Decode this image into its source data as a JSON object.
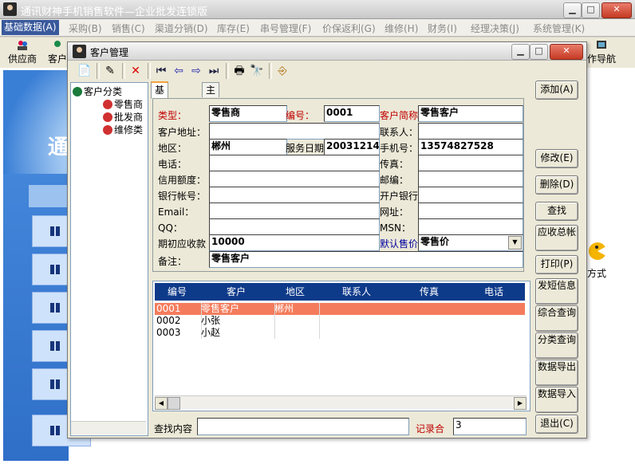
{
  "app": {
    "title": "通讯财神手机销售软件—企业批发连锁版"
  },
  "menu": [
    {
      "label": "基础数据(A)",
      "active": true
    },
    {
      "label": "采购(B)"
    },
    {
      "label": "销售(C)"
    },
    {
      "label": "渠道分销(D)"
    },
    {
      "label": "库存(E)"
    },
    {
      "label": "串号管理(F)"
    },
    {
      "label": "价保返利(G)"
    },
    {
      "label": "维修(H)"
    },
    {
      "label": "财务(I)"
    },
    {
      "label": "经理决策(J)"
    },
    {
      "label": "系统管理(K)"
    }
  ],
  "toolbar": {
    "supplier": "供应商",
    "customer": "客户",
    "nav": "作导航"
  },
  "background": {
    "payment_label": "方式"
  },
  "dialog": {
    "title": "客户管理",
    "tree": {
      "root": "客户分类",
      "children": [
        "零售商",
        "批发商",
        "维修类"
      ]
    },
    "tabs": [
      "基本资料",
      "主要联系人"
    ],
    "form": {
      "type_label": "类型：",
      "type_value": "零售商",
      "code_label": "编号：",
      "code_value": "0001",
      "short_label": "客户简称",
      "short_value": "零售客户",
      "address_label": "客户地址：",
      "address_value": "",
      "contact_label": "联系人：",
      "contact_value": "",
      "region_label": "地区：",
      "region_value": "郴州",
      "service_date_label": "服务日期",
      "service_date_value": "20031214",
      "mobile_label": "手机号：",
      "mobile_value": "13574827528",
      "phone_label": "电话：",
      "phone_value": "",
      "fax_label": "传真：",
      "fax_value": "",
      "credit_label": "信用额度：",
      "credit_value": "",
      "postcode_label": "邮编：",
      "postcode_value": "",
      "bank_label": "银行帐号：",
      "bank_value": "",
      "openbank_label": "开户银行",
      "openbank_value": "",
      "email_label": "Email：",
      "email_value": "",
      "web_label": "网址：",
      "web_value": "",
      "qq_label": "QQ：",
      "qq_value": "",
      "msn_label": "MSN：",
      "msn_value": "",
      "initial_ar_label": "期初应收款",
      "initial_ar_value": "10000",
      "default_price_label": "默认售价",
      "default_price_value": "零售价",
      "note_label": "备注：",
      "note_value": "零售客户"
    },
    "grid": {
      "columns": [
        "编号",
        "客户",
        "地区",
        "联系人",
        "传真",
        "电话"
      ],
      "rows": [
        {
          "code": "0001",
          "name": "零售客户",
          "region": "郴州",
          "selected": true
        },
        {
          "code": "0002",
          "name": "小张",
          "region": ""
        },
        {
          "code": "0003",
          "name": "小赵",
          "region": ""
        }
      ]
    },
    "search_label": "查找内容",
    "search_value": "",
    "record_label": "记录合",
    "record_count": "3",
    "buttons": {
      "add": "添加(A)",
      "edit": "修改(E)",
      "delete": "删除(D)",
      "find": "查找",
      "receivable": "应收总帐",
      "print": "打印(P)",
      "sms": "发短信息",
      "combined_query": "综合查询",
      "category_query": "分类查询",
      "export": "数据导出",
      "import": "数据导入",
      "exit": "退出(C)"
    }
  }
}
